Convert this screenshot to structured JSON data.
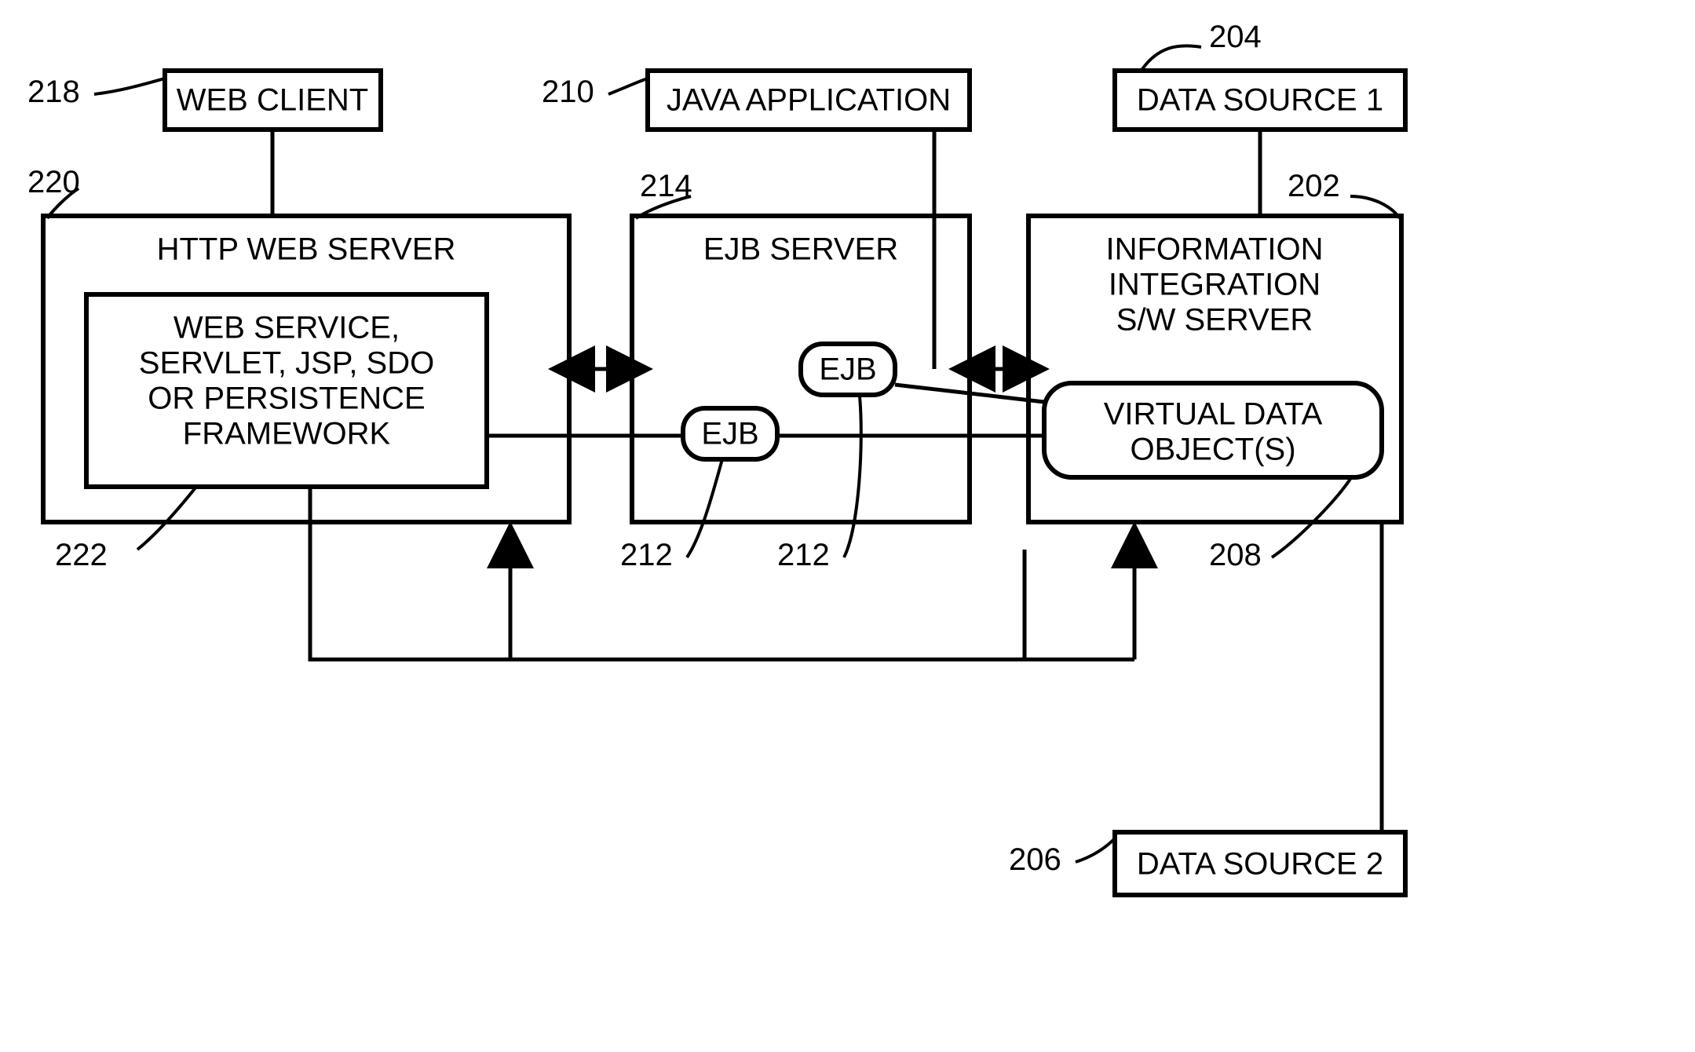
{
  "refs": {
    "r202": "202",
    "r204": "204",
    "r206": "206",
    "r208": "208",
    "r210": "210",
    "r212a": "212",
    "r212b": "212",
    "r214": "214",
    "r218": "218",
    "r220": "220",
    "r222": "222"
  },
  "boxes": {
    "web_client": "WEB CLIENT",
    "java_app": "JAVA APPLICATION",
    "ds1": "DATA SOURCE 1",
    "ds2": "DATA SOURCE 2",
    "http_server": "HTTP WEB SERVER",
    "ejb_server": "EJB SERVER",
    "iis_line1": "INFORMATION",
    "iis_line2": "INTEGRATION",
    "iis_line3": "S/W SERVER",
    "ws_line1": "WEB SERVICE,",
    "ws_line2": "SERVLET, JSP, SDO",
    "ws_line3": "OR PERSISTENCE",
    "ws_line4": "FRAMEWORK",
    "ejb": "EJB",
    "vdo_line1": "VIRTUAL DATA",
    "vdo_line2": "OBJECT(S)"
  }
}
